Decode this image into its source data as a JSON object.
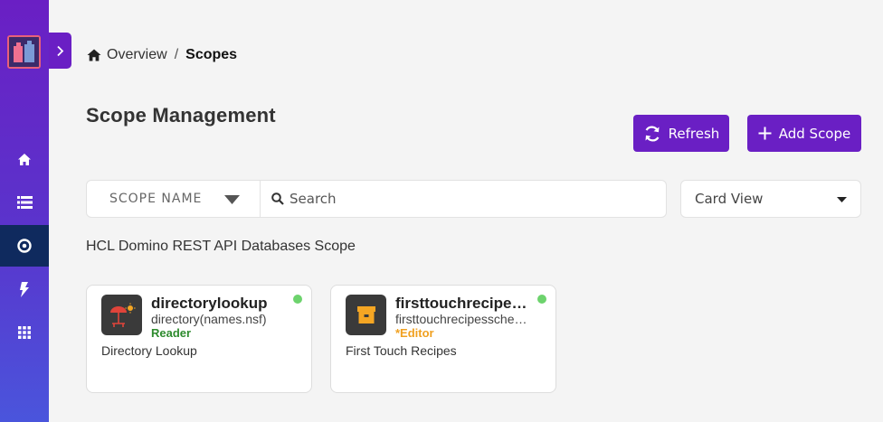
{
  "sidebar": {
    "items": [
      {
        "icon": "home-icon"
      },
      {
        "icon": "list-icon"
      },
      {
        "icon": "scope-icon",
        "active": true
      },
      {
        "icon": "bolt-icon"
      },
      {
        "icon": "apps-grid-icon"
      }
    ]
  },
  "breadcrumb": {
    "home_label": "Overview",
    "separator": "/",
    "current": "Scopes"
  },
  "page": {
    "title": "Scope Management",
    "section_label": "HCL Domino REST API Databases Scope"
  },
  "toolbar": {
    "refresh_label": "Refresh",
    "add_label": "Add Scope"
  },
  "filter": {
    "field_label": "SCOPE NAME",
    "search_placeholder": "Search",
    "view_label": "Card View"
  },
  "cards": [
    {
      "name": "directorylookup",
      "file": "directory(names.nsf)",
      "role": "Reader",
      "role_color": "#2e8b2e",
      "description": "Directory Lookup",
      "icon": "umbrella-table-icon",
      "status_color": "#6dd36d"
    },
    {
      "name": "firsttouchrecipesscheme",
      "file": "firsttouchrecipesscheme",
      "role": "*Editor",
      "role_color": "#f0a020",
      "description": "First Touch Recipes",
      "icon": "package-icon",
      "status_color": "#6dd36d"
    }
  ],
  "colors": {
    "accent": "#6a1fc4",
    "sidebar_active": "#0f2a5e",
    "background": "#f4f4f4"
  }
}
